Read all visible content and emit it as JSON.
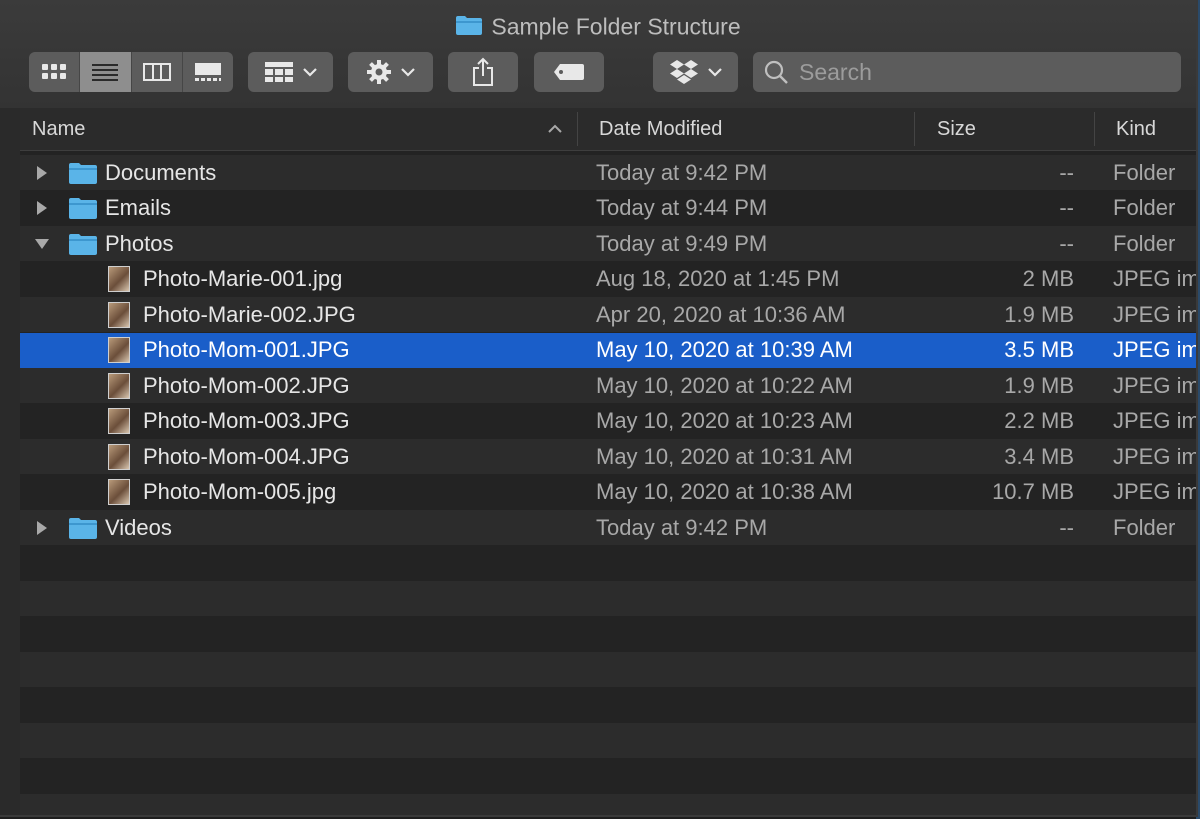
{
  "window": {
    "title": "Sample Folder Structure"
  },
  "toolbar": {
    "view_modes": [
      {
        "name": "icon-view",
        "icon": "grid-icon",
        "active": false
      },
      {
        "name": "list-view",
        "icon": "list-icon",
        "active": true
      },
      {
        "name": "column-view",
        "icon": "columns-icon",
        "active": false
      },
      {
        "name": "gallery-view",
        "icon": "gallery-icon",
        "active": false
      }
    ],
    "search": {
      "placeholder": "Search",
      "value": ""
    }
  },
  "columns": {
    "name": "Name",
    "date": "Date Modified",
    "size": "Size",
    "kind": "Kind"
  },
  "rows": [
    {
      "name": "Documents",
      "date": "Today at 9:42 PM",
      "size": "--",
      "kind": "Folder",
      "type": "folder",
      "expanded": false,
      "level": 0
    },
    {
      "name": "Emails",
      "date": "Today at 9:44 PM",
      "size": "--",
      "kind": "Folder",
      "type": "folder",
      "expanded": false,
      "level": 0
    },
    {
      "name": "Photos",
      "date": "Today at 9:49 PM",
      "size": "--",
      "kind": "Folder",
      "type": "folder",
      "expanded": true,
      "level": 0
    },
    {
      "name": "Photo-Marie-001.jpg",
      "date": "Aug 18, 2020 at 1:45 PM",
      "size": "2 MB",
      "kind": "JPEG im",
      "type": "image",
      "level": 1
    },
    {
      "name": "Photo-Marie-002.JPG",
      "date": "Apr 20, 2020 at 10:36 AM",
      "size": "1.9 MB",
      "kind": "JPEG im",
      "type": "image",
      "level": 1
    },
    {
      "name": "Photo-Mom-001.JPG",
      "date": "May 10, 2020 at 10:39 AM",
      "size": "3.5 MB",
      "kind": "JPEG im",
      "type": "image",
      "level": 1,
      "selected": true
    },
    {
      "name": "Photo-Mom-002.JPG",
      "date": "May 10, 2020 at 10:22 AM",
      "size": "1.9 MB",
      "kind": "JPEG im",
      "type": "image",
      "level": 1
    },
    {
      "name": "Photo-Mom-003.JPG",
      "date": "May 10, 2020 at 10:23 AM",
      "size": "2.2 MB",
      "kind": "JPEG im",
      "type": "image",
      "level": 1
    },
    {
      "name": "Photo-Mom-004.JPG",
      "date": "May 10, 2020 at 10:31 AM",
      "size": "3.4 MB",
      "kind": "JPEG im",
      "type": "image",
      "level": 1
    },
    {
      "name": "Photo-Mom-005.jpg",
      "date": "May 10, 2020 at 10:38 AM",
      "size": "10.7 MB",
      "kind": "JPEG im",
      "type": "image",
      "level": 1
    },
    {
      "name": "Videos",
      "date": "Today at 9:42 PM",
      "size": "--",
      "kind": "Folder",
      "type": "folder",
      "expanded": false,
      "level": 0
    }
  ],
  "colors": {
    "selection": "#1a5ec9",
    "folder": "#5ab4e8"
  }
}
